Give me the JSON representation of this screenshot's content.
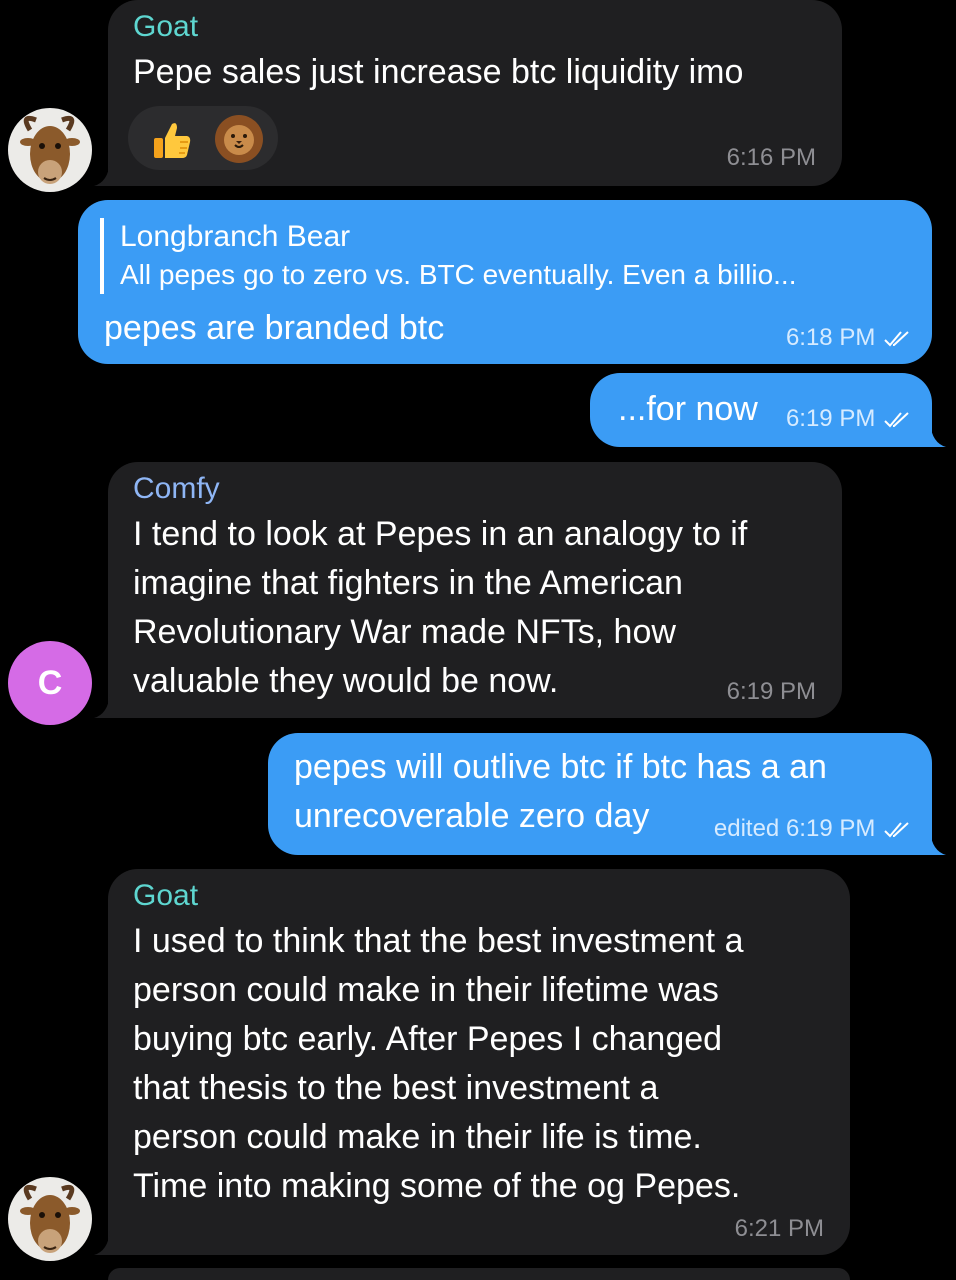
{
  "messages": [
    {
      "sender": "Goat",
      "text": "Pepe sales just increase btc liquidity imo",
      "time": "6:16 PM",
      "reactions": [
        "thumbs-up-icon",
        "lion-icon"
      ]
    },
    {
      "reply_to": {
        "name": "Longbranch Bear",
        "text": "All pepes go to zero vs. BTC eventually.  Even a billio..."
      },
      "text": "pepes are branded btc",
      "time": "6:18 PM"
    },
    {
      "text": "...for now",
      "time": "6:19 PM"
    },
    {
      "sender": "Comfy",
      "avatar_letter": "C",
      "lines": [
        "I tend to look at Pepes in an analogy to if",
        "imagine that fighters in the American",
        "Revolutionary War made NFTs, how",
        "valuable they would be now."
      ],
      "time": "6:19 PM"
    },
    {
      "lines": [
        "pepes will outlive btc if btc has a an",
        "unrecoverable zero day"
      ],
      "time": "edited 6:19 PM"
    },
    {
      "sender": "Goat",
      "lines": [
        "I used to think that the best investment a",
        "person could make in their lifetime was",
        "buying btc early. After Pepes I changed",
        "that thesis to the best investment a",
        "person could make in their life is time.",
        "Time into making some of the og Pepes."
      ],
      "time": "6:21 PM"
    }
  ],
  "colors": {
    "background": "#000000",
    "incoming_bubble": "#1f1f21",
    "outgoing_bubble": "#3b9cf5",
    "goat_name": "#5ed6d0",
    "comfy_name": "#8fb6f5",
    "comfy_avatar": "#d56be6"
  }
}
